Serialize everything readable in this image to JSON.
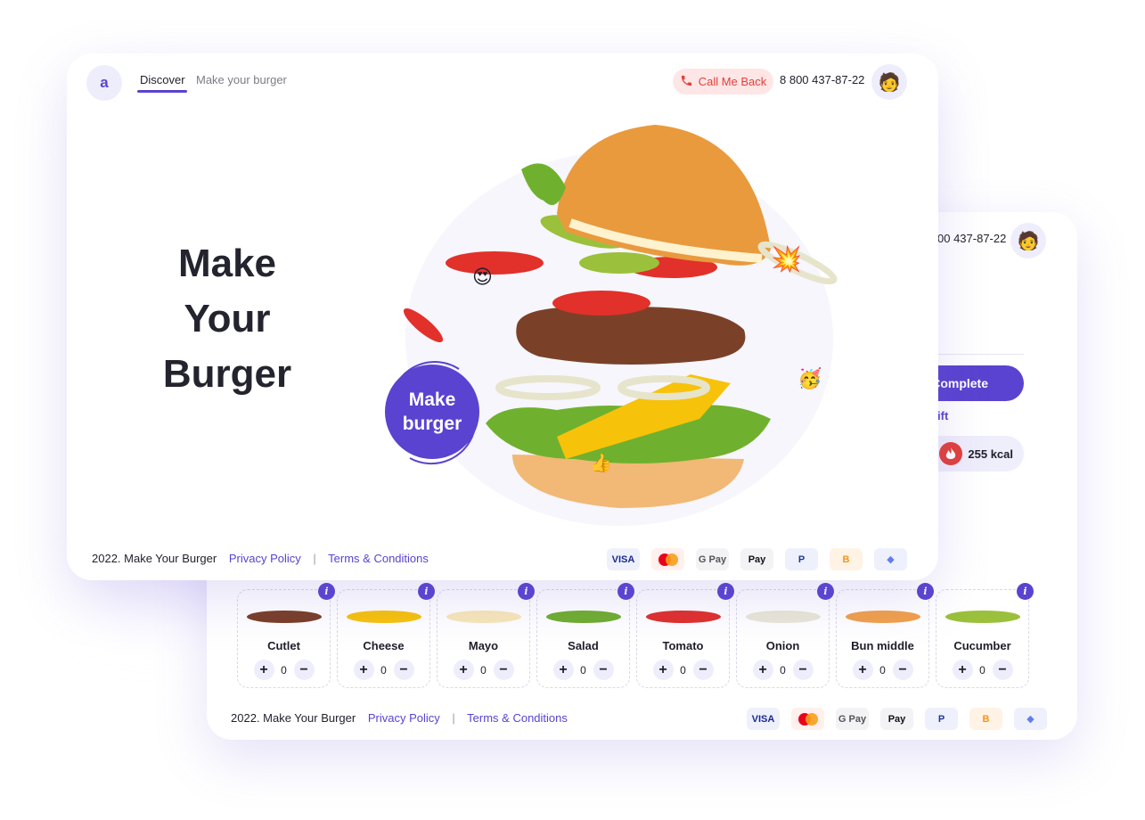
{
  "back_screen": {
    "phone": "00 437-87-22",
    "avatar_icon": "user-avatar-icon",
    "complete_label": "Complete",
    "gift_label": "ift",
    "kcal_label": "255 kcal",
    "ingredients": [
      {
        "name": "Cutlet",
        "qty": "0",
        "color": "#7a3e26"
      },
      {
        "name": "Cheese",
        "qty": "0",
        "color": "#f7c20a"
      },
      {
        "name": "Mayo",
        "qty": "0",
        "color": "#f8e7b8"
      },
      {
        "name": "Salad",
        "qty": "0",
        "color": "#6fae2e"
      },
      {
        "name": "Tomato",
        "qty": "0",
        "color": "#e0302a"
      },
      {
        "name": "Onion",
        "qty": "0",
        "color": "#e9e7d6"
      },
      {
        "name": "Bun middle",
        "qty": "0",
        "color": "#f1a04a"
      },
      {
        "name": "Cucumber",
        "qty": "0",
        "color": "#9bc03b"
      }
    ],
    "info_icon_label": "i",
    "plus_label": "+",
    "minus_label": "−",
    "footer": {
      "copyright": "2022. Make Your Burger",
      "privacy": "Privacy Policy",
      "separator": "|",
      "terms": "Terms & Conditions"
    }
  },
  "front_screen": {
    "logo": "a",
    "nav": {
      "discover": "Discover",
      "make": "Make your burger"
    },
    "callback_label": "Call Me Back",
    "phone": "8 800 437-87-22",
    "hero_title": [
      "Make",
      "Your",
      "Burger"
    ],
    "make_button": [
      "Make",
      "burger"
    ],
    "footer": {
      "copyright": "2022. Make Your Burger",
      "privacy": "Privacy Policy",
      "separator": "|",
      "terms": "Terms & Conditions"
    }
  },
  "payments": [
    {
      "icon": "visa-icon",
      "label": "VISA",
      "bg": "#eef0fb",
      "fg": "#1a2a8f"
    },
    {
      "icon": "mastercard-icon",
      "label": "",
      "bg": "#fff0ee",
      "fg": "#e2403a"
    },
    {
      "icon": "google-pay-icon",
      "label": "G Pay",
      "bg": "#f3f3f6",
      "fg": "#555"
    },
    {
      "icon": "apple-pay-icon",
      "label": "Pay",
      "bg": "#f3f3f6",
      "fg": "#111"
    },
    {
      "icon": "paypal-icon",
      "label": "P",
      "bg": "#eef1fb",
      "fg": "#1b3b8f"
    },
    {
      "icon": "bitcoin-icon",
      "label": "B",
      "bg": "#fff3e6",
      "fg": "#f7931a"
    },
    {
      "icon": "ethereum-icon",
      "label": "◆",
      "bg": "#eef0fb",
      "fg": "#627eea"
    }
  ],
  "colors": {
    "accent": "#5a43d0",
    "callback_bg": "#ffe6e6",
    "callback_fg": "#e2403a"
  }
}
